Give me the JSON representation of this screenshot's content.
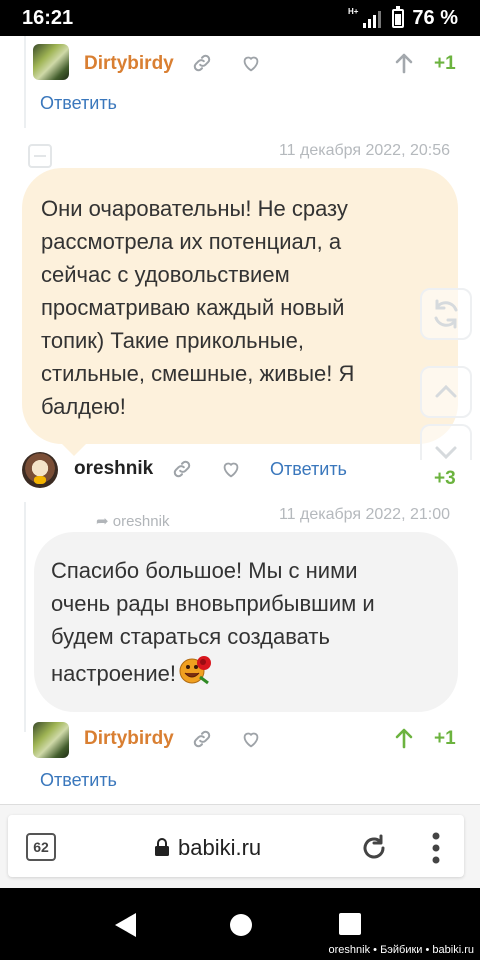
{
  "status_bar": {
    "time": "16:21",
    "network": "H+",
    "battery": "76 %",
    "battery_level": 0.76
  },
  "comments": [
    {
      "author": "Dirtybirdy",
      "rating": "+1",
      "reply_label": "Ответить"
    },
    {
      "timestamp": "11 декабря 2022, 20:56",
      "text": "Они очаровательны! Не сразу рассмотрела их потенциал, а сейчас с удовольствием просматриваю каждый новый топик) Такие прикольные, стильные, смешные, живые! Я балдею!",
      "author": "oreshnik",
      "rating": "+3",
      "reply_label": "Ответить"
    },
    {
      "mention": "oreshnik",
      "timestamp": "11 декабря 2022, 21:00",
      "text": "Спасибо большое! Мы с ними очень рады вновьприбывшим и будем стараться создавать настроение!",
      "author": "Dirtybirdy",
      "rating": "+1",
      "reply_label": "Ответить"
    }
  ],
  "browser": {
    "tab_count": "62",
    "url": "babiki.ru"
  },
  "watermark": "oreshnik • Бэйбики • babiki.ru",
  "colors": {
    "author_accent": "#d97f32",
    "link": "#3a77bc",
    "rating": "#6cb33f",
    "bubble_yellow": "#fdf1dc",
    "bubble_grey": "#f3f3f3"
  }
}
